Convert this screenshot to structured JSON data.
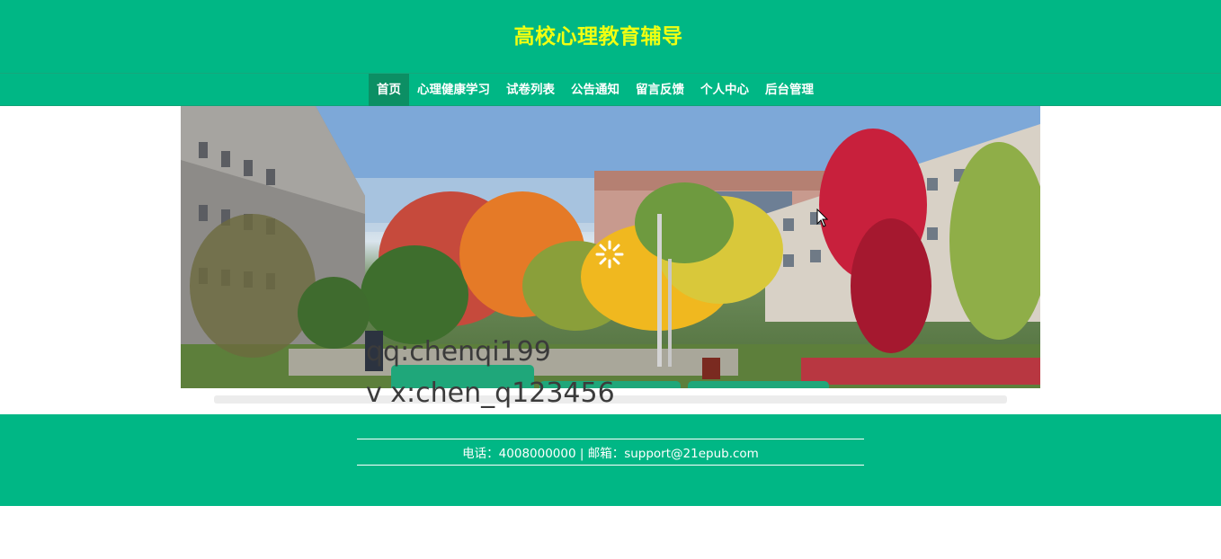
{
  "header": {
    "title": "高校心理教育辅导"
  },
  "nav": {
    "items": [
      {
        "label": "首页",
        "active": true
      },
      {
        "label": "心理健康学习",
        "active": false
      },
      {
        "label": "试卷列表",
        "active": false
      },
      {
        "label": "公告通知",
        "active": false
      },
      {
        "label": "留言反馈",
        "active": false
      },
      {
        "label": "个人中心",
        "active": false
      },
      {
        "label": "后台管理",
        "active": false
      }
    ]
  },
  "overlay": {
    "line1": "qq:chenqi199",
    "line2": "v x:chen_q123456"
  },
  "footer": {
    "contact": "电话：4008000000 | 邮箱：support@21epub.com"
  },
  "colors": {
    "brand": "#00b785",
    "title": "#f0ff12",
    "active_nav": "#0c8f64"
  }
}
